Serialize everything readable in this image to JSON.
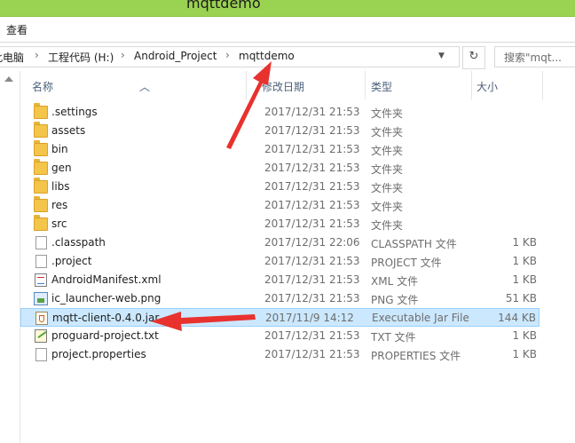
{
  "window": {
    "title": "mqttdemo"
  },
  "ribbon": {
    "view_tab": "查看"
  },
  "address": {
    "crumbs": [
      "此电脑",
      "工程代码 (H:)",
      "Android_Project",
      "mqttdemo"
    ],
    "search_placeholder": "搜索\"mqt..."
  },
  "columns": {
    "name": "名称",
    "date": "修改日期",
    "type": "类型",
    "size": "大小"
  },
  "files": [
    {
      "name": ".settings",
      "date": "2017/12/31 21:53",
      "type": "文件夹",
      "size": "",
      "icon": "folder-icon"
    },
    {
      "name": "assets",
      "date": "2017/12/31 21:53",
      "type": "文件夹",
      "size": "",
      "icon": "folder-icon"
    },
    {
      "name": "bin",
      "date": "2017/12/31 21:53",
      "type": "文件夹",
      "size": "",
      "icon": "folder-icon"
    },
    {
      "name": "gen",
      "date": "2017/12/31 21:53",
      "type": "文件夹",
      "size": "",
      "icon": "folder-icon"
    },
    {
      "name": "libs",
      "date": "2017/12/31 21:53",
      "type": "文件夹",
      "size": "",
      "icon": "folder-icon"
    },
    {
      "name": "res",
      "date": "2017/12/31 21:53",
      "type": "文件夹",
      "size": "",
      "icon": "folder-icon"
    },
    {
      "name": "src",
      "date": "2017/12/31 21:53",
      "type": "文件夹",
      "size": "",
      "icon": "folder-icon"
    },
    {
      "name": ".classpath",
      "date": "2017/12/31 22:06",
      "type": "CLASSPATH 文件",
      "size": "1 KB",
      "icon": "file-icon"
    },
    {
      "name": ".project",
      "date": "2017/12/31 21:53",
      "type": "PROJECT 文件",
      "size": "1 KB",
      "icon": "file-icon"
    },
    {
      "name": "AndroidManifest.xml",
      "date": "2017/12/31 21:53",
      "type": "XML 文件",
      "size": "1 KB",
      "icon": "xml-file-icon"
    },
    {
      "name": "ic_launcher-web.png",
      "date": "2017/12/31 21:53",
      "type": "PNG 文件",
      "size": "51 KB",
      "icon": "image-file-icon"
    },
    {
      "name": "mqtt-client-0.4.0.jar",
      "date": "2017/11/9 14:12",
      "type": "Executable Jar File",
      "size": "144 KB",
      "icon": "jar-file-icon"
    },
    {
      "name": "proguard-project.txt",
      "date": "2017/12/31 21:53",
      "type": "TXT 文件",
      "size": "1 KB",
      "icon": "text-file-icon"
    },
    {
      "name": "project.properties",
      "date": "2017/12/31 21:53",
      "type": "PROPERTIES 文件",
      "size": "1 KB",
      "icon": "file-icon"
    }
  ],
  "selected_row": 11,
  "colors": {
    "titlebar": "#9ad251",
    "selection": "#cce8ff",
    "annotation_arrow": "#e8322e"
  }
}
